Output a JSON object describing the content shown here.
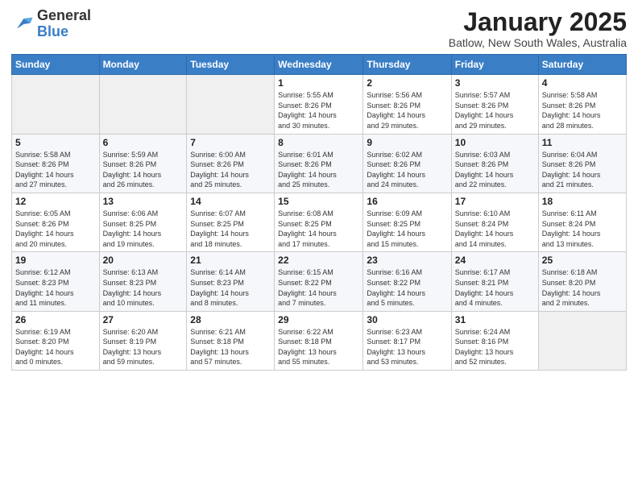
{
  "header": {
    "logo_general": "General",
    "logo_blue": "Blue",
    "month": "January 2025",
    "location": "Batlow, New South Wales, Australia"
  },
  "weekdays": [
    "Sunday",
    "Monday",
    "Tuesday",
    "Wednesday",
    "Thursday",
    "Friday",
    "Saturday"
  ],
  "weeks": [
    [
      {
        "day": "",
        "info": ""
      },
      {
        "day": "",
        "info": ""
      },
      {
        "day": "",
        "info": ""
      },
      {
        "day": "1",
        "info": "Sunrise: 5:55 AM\nSunset: 8:26 PM\nDaylight: 14 hours\nand 30 minutes."
      },
      {
        "day": "2",
        "info": "Sunrise: 5:56 AM\nSunset: 8:26 PM\nDaylight: 14 hours\nand 29 minutes."
      },
      {
        "day": "3",
        "info": "Sunrise: 5:57 AM\nSunset: 8:26 PM\nDaylight: 14 hours\nand 29 minutes."
      },
      {
        "day": "4",
        "info": "Sunrise: 5:58 AM\nSunset: 8:26 PM\nDaylight: 14 hours\nand 28 minutes."
      }
    ],
    [
      {
        "day": "5",
        "info": "Sunrise: 5:58 AM\nSunset: 8:26 PM\nDaylight: 14 hours\nand 27 minutes."
      },
      {
        "day": "6",
        "info": "Sunrise: 5:59 AM\nSunset: 8:26 PM\nDaylight: 14 hours\nand 26 minutes."
      },
      {
        "day": "7",
        "info": "Sunrise: 6:00 AM\nSunset: 8:26 PM\nDaylight: 14 hours\nand 25 minutes."
      },
      {
        "day": "8",
        "info": "Sunrise: 6:01 AM\nSunset: 8:26 PM\nDaylight: 14 hours\nand 25 minutes."
      },
      {
        "day": "9",
        "info": "Sunrise: 6:02 AM\nSunset: 8:26 PM\nDaylight: 14 hours\nand 24 minutes."
      },
      {
        "day": "10",
        "info": "Sunrise: 6:03 AM\nSunset: 8:26 PM\nDaylight: 14 hours\nand 22 minutes."
      },
      {
        "day": "11",
        "info": "Sunrise: 6:04 AM\nSunset: 8:26 PM\nDaylight: 14 hours\nand 21 minutes."
      }
    ],
    [
      {
        "day": "12",
        "info": "Sunrise: 6:05 AM\nSunset: 8:26 PM\nDaylight: 14 hours\nand 20 minutes."
      },
      {
        "day": "13",
        "info": "Sunrise: 6:06 AM\nSunset: 8:25 PM\nDaylight: 14 hours\nand 19 minutes."
      },
      {
        "day": "14",
        "info": "Sunrise: 6:07 AM\nSunset: 8:25 PM\nDaylight: 14 hours\nand 18 minutes."
      },
      {
        "day": "15",
        "info": "Sunrise: 6:08 AM\nSunset: 8:25 PM\nDaylight: 14 hours\nand 17 minutes."
      },
      {
        "day": "16",
        "info": "Sunrise: 6:09 AM\nSunset: 8:25 PM\nDaylight: 14 hours\nand 15 minutes."
      },
      {
        "day": "17",
        "info": "Sunrise: 6:10 AM\nSunset: 8:24 PM\nDaylight: 14 hours\nand 14 minutes."
      },
      {
        "day": "18",
        "info": "Sunrise: 6:11 AM\nSunset: 8:24 PM\nDaylight: 14 hours\nand 13 minutes."
      }
    ],
    [
      {
        "day": "19",
        "info": "Sunrise: 6:12 AM\nSunset: 8:23 PM\nDaylight: 14 hours\nand 11 minutes."
      },
      {
        "day": "20",
        "info": "Sunrise: 6:13 AM\nSunset: 8:23 PM\nDaylight: 14 hours\nand 10 minutes."
      },
      {
        "day": "21",
        "info": "Sunrise: 6:14 AM\nSunset: 8:23 PM\nDaylight: 14 hours\nand 8 minutes."
      },
      {
        "day": "22",
        "info": "Sunrise: 6:15 AM\nSunset: 8:22 PM\nDaylight: 14 hours\nand 7 minutes."
      },
      {
        "day": "23",
        "info": "Sunrise: 6:16 AM\nSunset: 8:22 PM\nDaylight: 14 hours\nand 5 minutes."
      },
      {
        "day": "24",
        "info": "Sunrise: 6:17 AM\nSunset: 8:21 PM\nDaylight: 14 hours\nand 4 minutes."
      },
      {
        "day": "25",
        "info": "Sunrise: 6:18 AM\nSunset: 8:20 PM\nDaylight: 14 hours\nand 2 minutes."
      }
    ],
    [
      {
        "day": "26",
        "info": "Sunrise: 6:19 AM\nSunset: 8:20 PM\nDaylight: 14 hours\nand 0 minutes."
      },
      {
        "day": "27",
        "info": "Sunrise: 6:20 AM\nSunset: 8:19 PM\nDaylight: 13 hours\nand 59 minutes."
      },
      {
        "day": "28",
        "info": "Sunrise: 6:21 AM\nSunset: 8:18 PM\nDaylight: 13 hours\nand 57 minutes."
      },
      {
        "day": "29",
        "info": "Sunrise: 6:22 AM\nSunset: 8:18 PM\nDaylight: 13 hours\nand 55 minutes."
      },
      {
        "day": "30",
        "info": "Sunrise: 6:23 AM\nSunset: 8:17 PM\nDaylight: 13 hours\nand 53 minutes."
      },
      {
        "day": "31",
        "info": "Sunrise: 6:24 AM\nSunset: 8:16 PM\nDaylight: 13 hours\nand 52 minutes."
      },
      {
        "day": "",
        "info": ""
      }
    ]
  ]
}
